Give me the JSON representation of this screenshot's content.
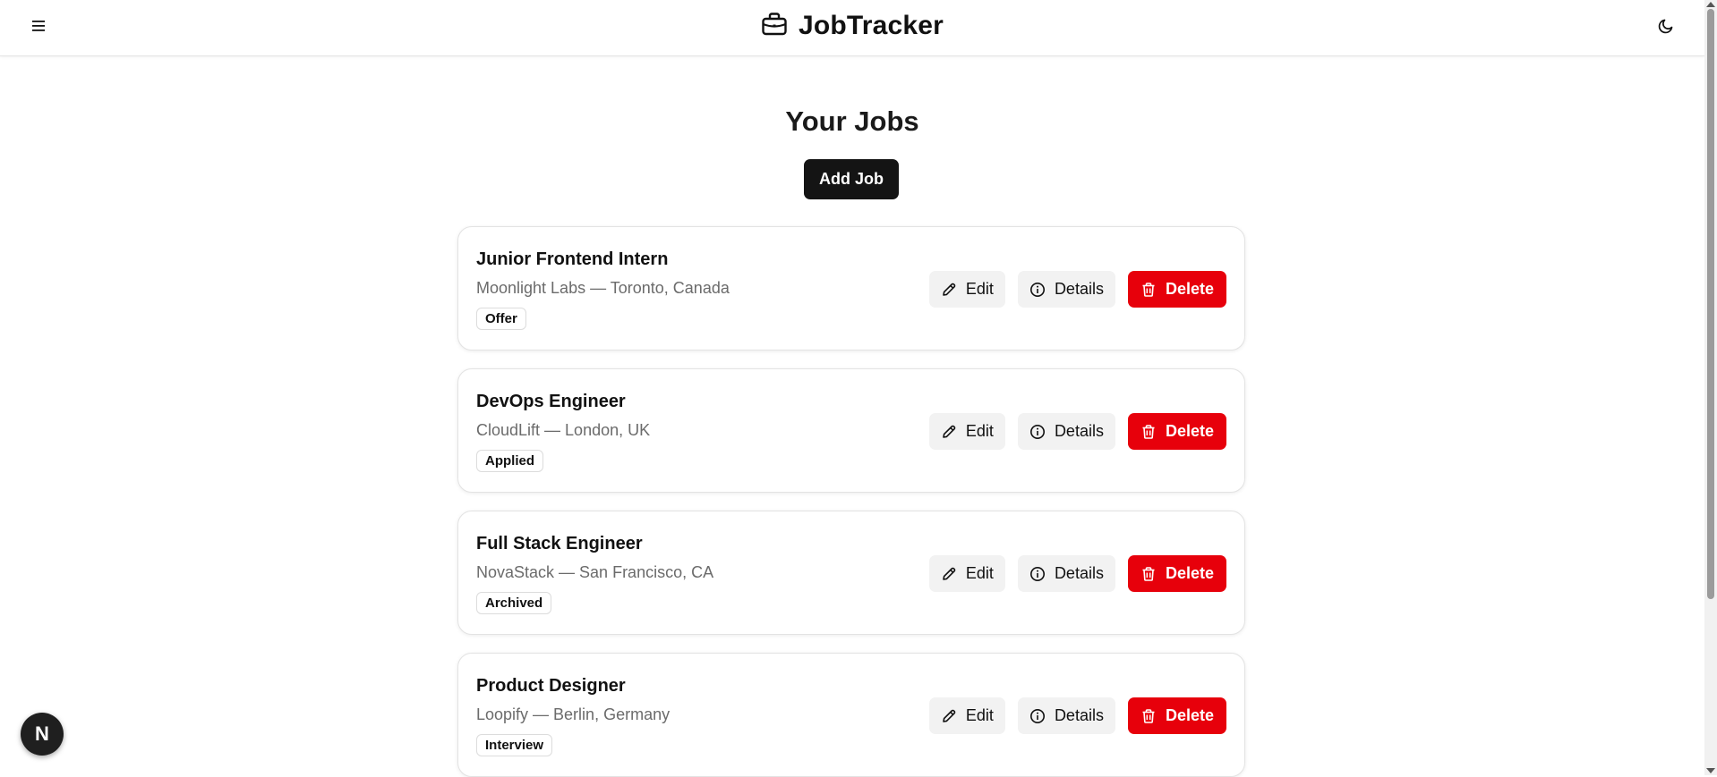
{
  "header": {
    "title": "JobTracker",
    "brand_icon": "briefcase-icon",
    "menu_icon": "hamburger-menu-icon",
    "theme_icon": "moon-icon"
  },
  "main": {
    "page_title": "Your Jobs",
    "add_button_label": "Add Job"
  },
  "jobs": [
    {
      "title": "Junior Frontend Intern",
      "subtitle": "Moonlight Labs — Toronto, Canada",
      "status": "Offer"
    },
    {
      "title": "DevOps Engineer",
      "subtitle": "CloudLift — London, UK",
      "status": "Applied"
    },
    {
      "title": "Full Stack Engineer",
      "subtitle": "NovaStack — San Francisco, CA",
      "status": "Archived"
    },
    {
      "title": "Product Designer",
      "subtitle": "Loopify — Berlin, Germany",
      "status": "Interview"
    }
  ],
  "actions": {
    "edit_label": "Edit",
    "details_label": "Details",
    "delete_label": "Delete",
    "edit_icon": "pencil-icon",
    "details_icon": "info-icon",
    "delete_icon": "trash-icon"
  },
  "colors": {
    "primary": "#141414",
    "danger": "#e7000b",
    "muted_text": "#6b6b6b",
    "button_light": "#f2f2f2"
  },
  "dev_badge": {
    "label": "N"
  }
}
